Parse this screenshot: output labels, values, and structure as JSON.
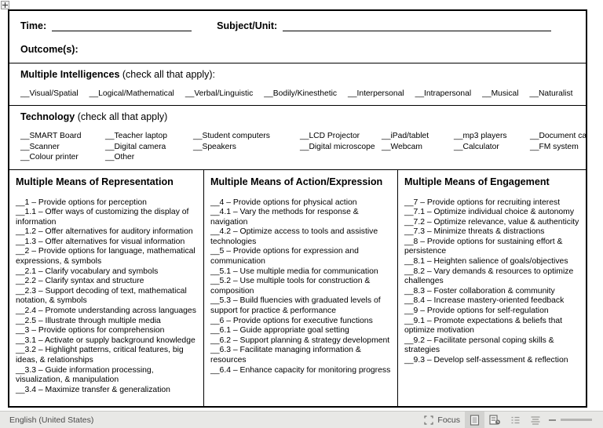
{
  "document": {
    "header": {
      "time_label": "Time:",
      "subject_label": "Subject/Unit:",
      "outcomes_label": "Outcome(s):",
      "time_value": "",
      "subject_value": ""
    },
    "multiple_intelligences": {
      "title_bold": "Multiple Intelligences",
      "title_rest": " (check all that apply):",
      "options": [
        "__Visual/Spatial",
        "__Logical/Mathematical",
        "__Verbal/Linguistic",
        "__Bodily/Kinesthetic",
        "__Interpersonal",
        "__Intrapersonal",
        "__Musical",
        "__Naturalist"
      ]
    },
    "technology": {
      "title_bold": "Technology",
      "title_rest": " (check all that apply)",
      "row1": [
        "__SMART Board",
        "__Teacher laptop",
        "__Student computers",
        "__LCD Projector",
        "__iPad/tablet",
        "__mp3 players",
        "__Document camera",
        "__Scanner"
      ],
      "row2": [
        "__Digital camera",
        "__Speakers",
        "__Digital microscope",
        "__Webcam",
        "__Calculator",
        "__FM system",
        "__Colour printer",
        "__Other"
      ]
    },
    "columns": [
      {
        "title": "Multiple Means of Representation",
        "items": [
          "__1 – Provide options for perception",
          "__1.1 – Offer ways of customizing the display of information",
          "__1.2 – Offer alternatives for auditory information",
          "__1.3 – Offer alternatives for visual information",
          "__2 – Provide options for language, mathematical expressions, & symbols",
          "__2.1 – Clarify vocabulary and symbols",
          "__2.2 – Clarify syntax and structure",
          "__2.3 – Support decoding of text, mathematical notation, & symbols",
          "__2.4 – Promote understanding across languages",
          "__2.5 – Illustrate through multiple media",
          "__3 – Provide options for comprehension",
          "__3.1 – Activate or supply background knowledge",
          "__3.2 – Highlight patterns, critical features, big ideas, & relationships",
          "__3.3 – Guide information processing, visualization, & manipulation",
          "__3.4 – Maximize transfer & generalization"
        ]
      },
      {
        "title": "Multiple Means of Action/Expression",
        "items": [
          "__4 – Provide options for physical action",
          "__4.1 – Vary the methods for response & navigation",
          "__4.2 – Optimize access to tools and assistive technologies",
          "__5 – Provide options for expression and communication",
          "__5.1 – Use multiple media for communication",
          "__5.2 – Use multiple tools for construction & composition",
          "__5.3 – Build fluencies with graduated levels of support for practice & performance",
          "__6 – Provide options for executive functions",
          "__6.1 – Guide appropriate goal setting",
          "__6.2 – Support planning & strategy development",
          "__6.3 – Facilitate managing information & resources",
          "__6.4 – Enhance capacity for monitoring progress"
        ]
      },
      {
        "title": "Multiple Means of Engagement",
        "items": [
          "__7 – Provide options for recruiting interest",
          "__7.1 – Optimize individual choice & autonomy",
          "__7.2 – Optimize relevance, value & authenticity",
          "__7.3 – Minimize threats & distractions",
          "__8 – Provide options for sustaining effort & persistence",
          "__8.1 – Heighten salience of goals/objectives",
          "__8.2 – Vary demands & resources to optimize challenges",
          "__8.3 – Foster collaboration & community",
          "__8.4 – Increase mastery-oriented feedback",
          "__9 – Provide options for self-regulation",
          "__9.1 – Promote expectations & beliefs that optimize motivation",
          "__9.2 – Facilitate personal coping skills & strategies",
          "__9.3 – Develop self-assessment & reflection"
        ]
      }
    ]
  },
  "statusbar": {
    "language": "English (United States)",
    "focus_label": "Focus",
    "icons": [
      "focus-frame-icon",
      "single-page-view-icon",
      "multi-page-view-icon",
      "book-view-icon",
      "outline-view-icon"
    ]
  },
  "colors": {
    "page_background": "#ffffff",
    "text": "#000000",
    "statusbar_background": "#e8e8e6",
    "statusbar_text": "#4a4a4a",
    "statusbar_active": "#d2d2d0"
  }
}
